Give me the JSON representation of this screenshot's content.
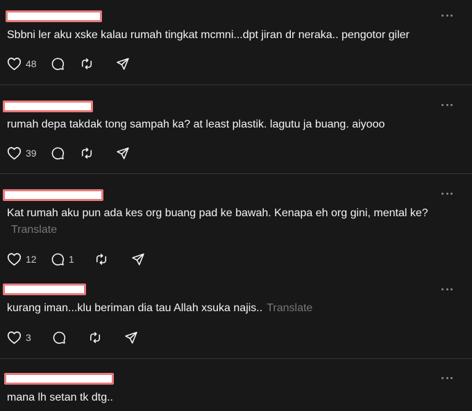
{
  "posts": [
    {
      "text": "Sbbni ler aku xske kalau rumah tingkat mcmni...dpt jiran dr neraka.. pengotor giler",
      "translate": "",
      "likes": "48",
      "replies": ""
    },
    {
      "text": "rumah depa takdak tong sampah ka? at least plastik. lagutu ja buang. aiyooo",
      "translate": "",
      "likes": "39",
      "replies": ""
    },
    {
      "text": "Kat rumah aku pun ada kes org buang pad ke bawah. Kenapa eh org gini, mental ke?",
      "translate": "Translate",
      "likes": "12",
      "replies": "1"
    },
    {
      "text": "kurang iman...klu beriman dia tau Allah xsuka najis..",
      "translate": "Translate",
      "likes": "3",
      "replies": ""
    },
    {
      "text": "mana lh setan tk dtg..",
      "translate": "",
      "likes": "",
      "replies": ""
    }
  ],
  "icons": {
    "like": "heart-icon",
    "reply": "comment-icon",
    "repost": "repost-icon",
    "share": "send-icon",
    "more": "more-icon"
  },
  "colors": {
    "background": "#181818",
    "text": "#f3f5f7",
    "muted": "#777777",
    "redaction_border": "#e87a7a"
  }
}
